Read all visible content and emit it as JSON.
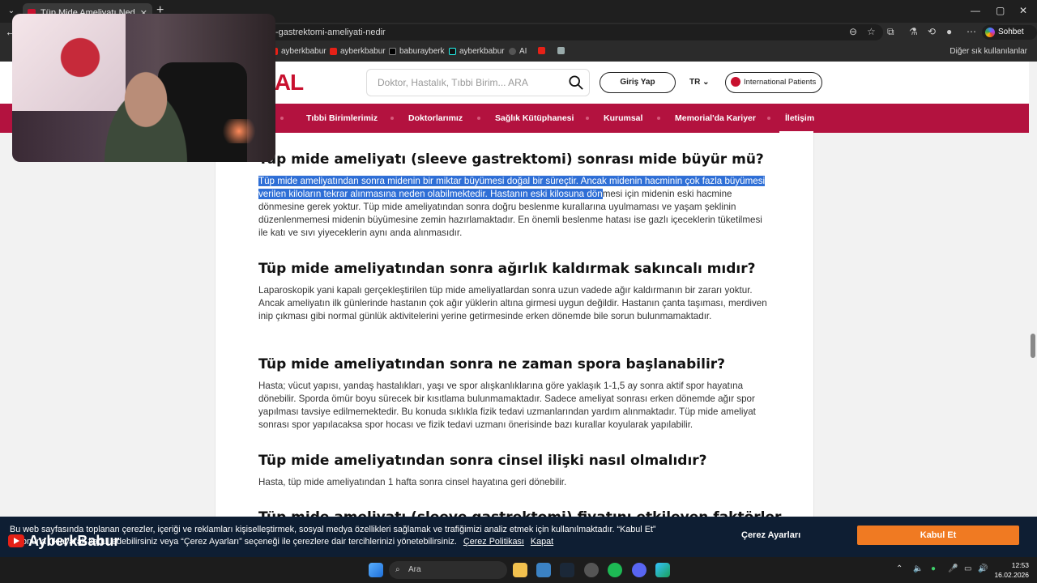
{
  "browser": {
    "tab_title": "Tüp Mide Ameliyatı Nedir? Nasıl Y",
    "url": "-gastrektomi-ameliyati-nedir",
    "new_tab": "+",
    "sohbet_label": "Sohbet et",
    "bookmarks": [
      {
        "label": "ayberkbabur",
        "icon": "youtube-icon"
      },
      {
        "label": "ayberkbabur",
        "icon": "youtube-icon"
      },
      {
        "label": "baburayberk",
        "icon": "x-icon"
      },
      {
        "label": "ayberkbabur",
        "icon": "tiktok-icon"
      },
      {
        "label": "AI",
        "icon": "ai-icon"
      }
    ],
    "other_bookmarks": "Diğer sık kullanılanlar"
  },
  "site": {
    "brand": "ORIAL",
    "search_placeholder": "Doktor, Hastalık, Tıbbi Birim... ARA",
    "login": "Giriş Yap",
    "lang": "TR",
    "international": "International Patients",
    "nav": [
      "Tıbbi Birimlerimiz",
      "Doktorlarımız",
      "Sağlık Kütüphanesi",
      "Kurumsal",
      "Memorial'da Kariyer",
      "İletişim"
    ]
  },
  "article": {
    "sections": [
      {
        "heading": "Tüp mide ameliyatı (sleeve gastrektomi) sonrası mide büyür mü?",
        "highlight": "Tüp mide ameliyatından sonra midenin bir miktar büyümesi doğal bir süreçtir. Ancak midenin hacminin çok fazla büyümesi verilen kiloların tekrar alınmasına neden olabilmektedir. Hastanın eski kilosuna dön",
        "text": "mesi için midenin eski hacmine dönmesine gerek yoktur. Tüp mide ameliyatından sonra doğru beslenme kurallarına uyulmaması ve yaşam şeklinin düzenlenmemesi midenin büyümesine zemin hazırlamaktadır. En önemli beslenme hatası ise gazlı içeceklerin tüketilmesi ile katı ve sıvı yiyeceklerin aynı anda alınmasıdır."
      },
      {
        "heading": "Tüp mide ameliyatından sonra ağırlık kaldırmak sakıncalı mıdır?",
        "text": "Laparoskopik yani kapalı gerçekleştirilen tüp mide ameliyatlardan sonra uzun vadede ağır kaldırmanın bir zararı yoktur. Ancak ameliyatın ilk günlerinde hastanın çok ağır yüklerin altına girmesi uygun değildir. Hastanın çanta taşıması, merdiven inip çıkması gibi normal günlük aktivitelerini yerine getirmesinde erken dönemde bile sorun bulunmamaktadır."
      },
      {
        "heading": "Tüp mide ameliyatından sonra ne zaman spora başlanabilir?",
        "text": "Hasta; vücut yapısı, yandaş hastalıkları, yaşı ve spor alışkanlıklarına göre yaklaşık 1-1,5 ay sonra aktif spor hayatına dönebilir. Sporda ömür boyu sürecek bir kısıtlama bulunmamaktadır. Sadece ameliyat sonrası erken dönemde ağır spor yapılması tavsiye edilmemektedir. Bu konuda sıklıkla fizik tedavi uzmanlarından yardım alınmaktadır. Tüp mide ameliyat sonrası spor yapılacaksa spor hocası ve fizik tedavi uzmanı önerisinde bazı kurallar koyularak yapılabilir."
      },
      {
        "heading": "Tüp mide ameliyatından sonra cinsel ilişki nasıl olmalıdır?",
        "text": "Hasta, tüp mide ameliyatından 1 hafta sonra cinsel hayatına geri dönebilir."
      },
      {
        "heading": "Tüp mide ameliyatı (sleeve gastrektomi) fiyatını etkileyen faktörler"
      }
    ]
  },
  "cookie": {
    "line1": "Bu web sayfasında toplanan çerezler, içeriği ve reklamları kişiselleştirmek, sosyal medya özellikleri sağlamak ve trafiğimizi analiz etmek için kullanılmaktadır. “Kabul Et”",
    "line2": "butonuna tıklayarak kabul edebilirsiniz veya “Çerez Ayarları” seçeneği ile çerezlere dair tercihlerinizi yönetebilirsiniz.",
    "policy": "Çerez Politikası",
    "close": "Kapat",
    "settings": "Çerez Ayarları",
    "accept": "Kabul Et"
  },
  "watermark": "AyberkBabur",
  "taskbar": {
    "search": "Ara",
    "time": "12:53",
    "date": "16.02.2026"
  },
  "colors": {
    "brand_red": "#c8102e",
    "nav_bg": "#b3123f",
    "cookie_bg": "#0e1e33",
    "accept_orange": "#f07a22",
    "selection": "#2f6fd6"
  }
}
